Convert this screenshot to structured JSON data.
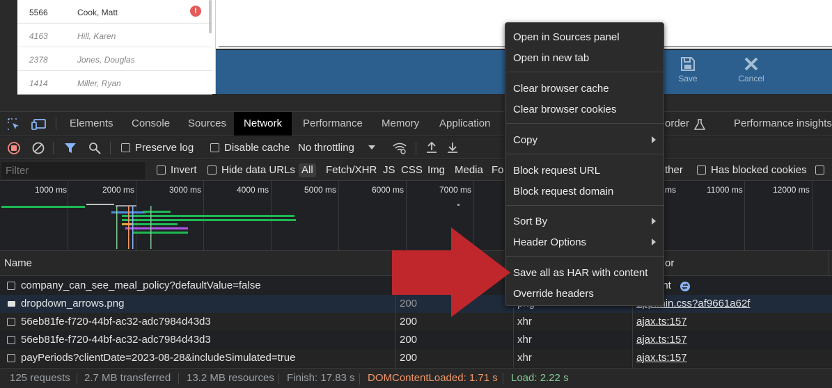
{
  "webpage": {
    "employees": [
      {
        "id": "5566",
        "name": "Cook, Matt",
        "alert": true
      },
      {
        "id": "4163",
        "name": "Hill, Karen",
        "alert": false
      },
      {
        "id": "2378",
        "name": "Jones, Douglas",
        "alert": false
      },
      {
        "id": "1414",
        "name": "Miller, Ryan",
        "alert": false
      }
    ],
    "alert_icon": "!",
    "save_label": "Save",
    "cancel_label": "Cancel"
  },
  "devtools": {
    "tabs": [
      "Elements",
      "Console",
      "Sources",
      "Network",
      "Performance",
      "Memory",
      "Application"
    ],
    "active_tab": "Network",
    "right_tabs": {
      "recorder": "order",
      "insights": "Performance insights"
    },
    "toolbar": {
      "preserve_log": "Preserve log",
      "disable_cache": "Disable cache",
      "throttling": "No throttling"
    },
    "filter": {
      "placeholder": "Filter",
      "invert": "Invert",
      "hide_data_urls": "Hide data URLs",
      "types": [
        "All",
        "Fetch/XHR",
        "JS",
        "CSS",
        "Img",
        "Media",
        "Fo"
      ],
      "other": "ther",
      "has_blocked_cookies": "Has blocked cookies"
    },
    "timeline_ticks": [
      "1000 ms",
      "2000 ms",
      "3000 ms",
      "4000 ms",
      "5000 ms",
      "6000 ms",
      "7000 ms",
      "ms",
      "11000 ms",
      "12000 ms"
    ],
    "columns": {
      "name": "Name",
      "initiator_partial": "or"
    },
    "requests": [
      {
        "name": "company_can_see_meal_policy?defaultValue=false",
        "status": "",
        "type": "",
        "initiator": "ght"
      },
      {
        "name": "dropdown_arrows.png",
        "status": "200",
        "type": "png",
        "initiator": "app.min.css?af9661a62f"
      },
      {
        "name": "56eb81fe-f720-44bf-ac32-adc7984d43d3",
        "status": "200",
        "type": "xhr",
        "initiator": "ajax.ts:157"
      },
      {
        "name": "56eb81fe-f720-44bf-ac32-adc7984d43d3",
        "status": "200",
        "type": "xhr",
        "initiator": "ajax.ts:157"
      },
      {
        "name": "payPeriods?clientDate=2023-08-28&includeSimulated=true",
        "status": "200",
        "type": "xhr",
        "initiator": "ajax.ts:157"
      }
    ],
    "status_bar": {
      "requests": "125 requests",
      "transferred": "2.7 MB transferred",
      "resources": "13.2 MB resources",
      "finish": "Finish: 17.83 s",
      "dom_content_loaded": "DOMContentLoaded: 1.71 s",
      "load": "Load: 2.22 s"
    },
    "colors": {
      "dcl": "#f29766",
      "load": "#81c995",
      "accent": "#8ab4f8",
      "record": "#f28b82"
    }
  },
  "context_menu": {
    "groups": [
      [
        {
          "label": "Open in Sources panel"
        },
        {
          "label": "Open in new tab"
        }
      ],
      [
        {
          "label": "Clear browser cache"
        },
        {
          "label": "Clear browser cookies"
        }
      ],
      [
        {
          "label": "Copy",
          "submenu": true
        }
      ],
      [
        {
          "label": "Block request URL"
        },
        {
          "label": "Block request domain"
        }
      ],
      [
        {
          "label": "Sort By",
          "submenu": true
        },
        {
          "label": "Header Options",
          "submenu": true
        }
      ],
      [
        {
          "label": "Save all as HAR with content"
        },
        {
          "label": "Override headers"
        }
      ]
    ]
  },
  "annotation": {
    "arrow_color": "#c0272d"
  }
}
